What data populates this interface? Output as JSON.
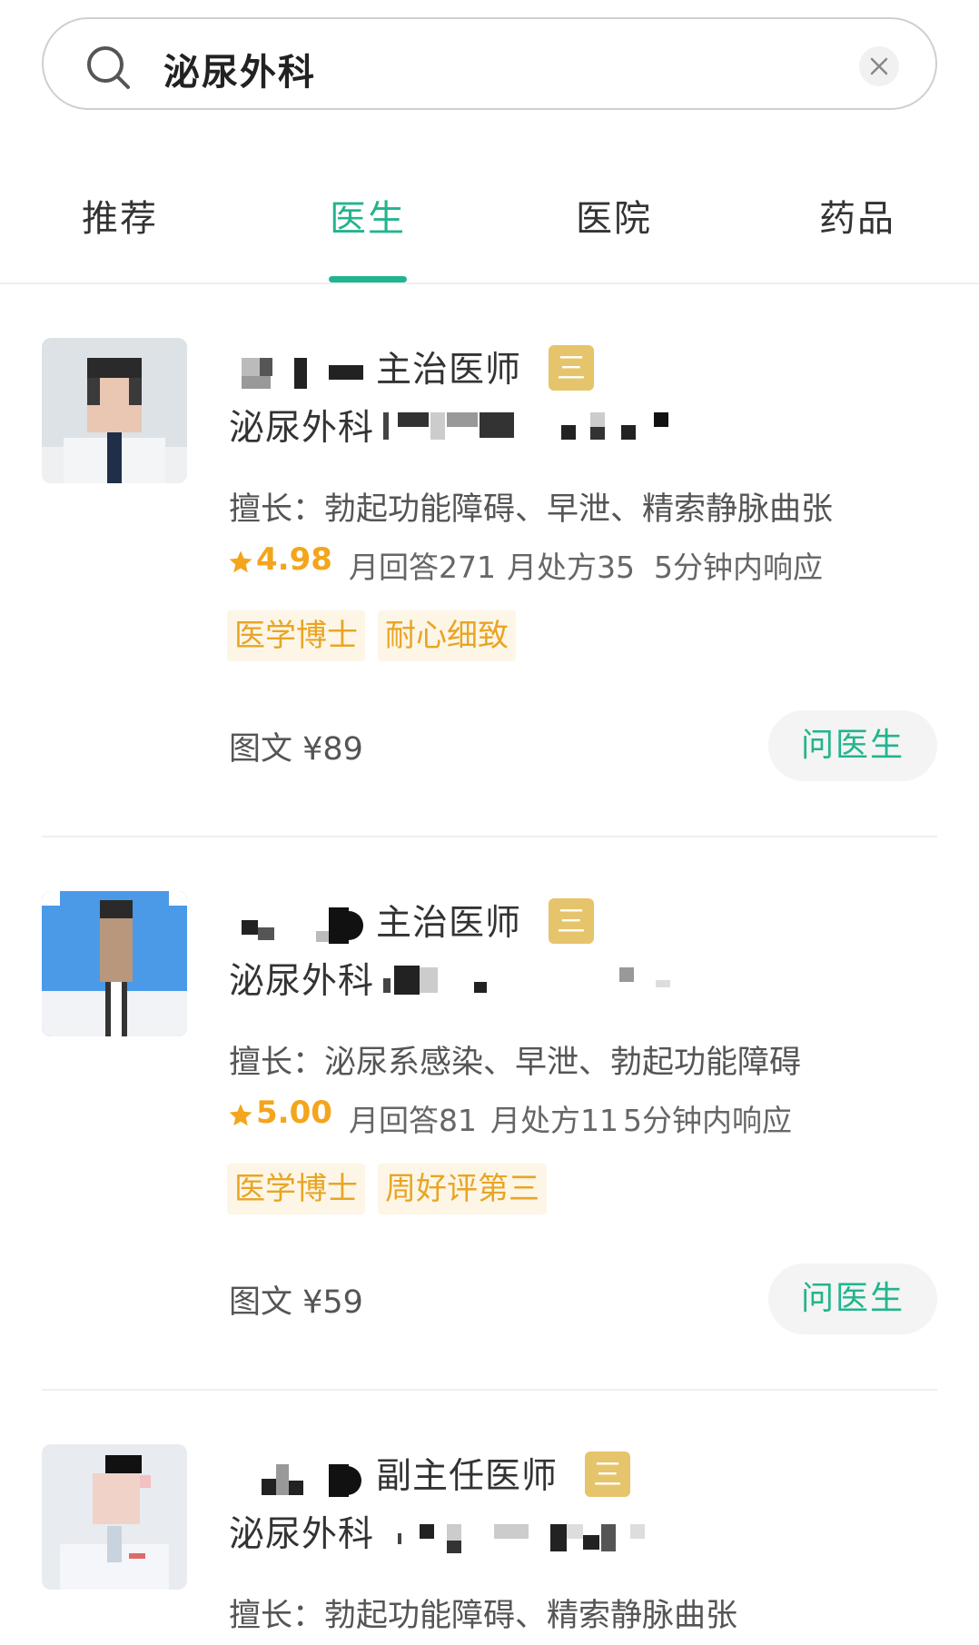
{
  "search": {
    "query": "泌尿外科",
    "icon": "search-icon",
    "clear_icon": "close-icon"
  },
  "tabs": [
    {
      "label": "推荐"
    },
    {
      "label": "医生",
      "active": true
    },
    {
      "label": "医院"
    },
    {
      "label": "药品"
    }
  ],
  "colors": {
    "accent": "#22b48e",
    "badge": "#e6c46b",
    "tag_text": "#e8a525",
    "rating": "#f3a51d"
  },
  "doctors": [
    {
      "title": "主治医师",
      "level_badge": "三甲",
      "department": "泌尿外科",
      "specialty": "擅长：勃起功能障碍、早泄、精索静脉曲张",
      "rating": "4.98",
      "monthly_answers": "月回答271",
      "monthly_prescriptions": "月处方35",
      "response": "5分钟内响应",
      "tags": [
        "医学博士",
        "耐心细致"
      ],
      "price": "图文 ¥89",
      "ask_label": "问医生"
    },
    {
      "title": "主治医师",
      "level_badge": "三甲",
      "department": "泌尿外科",
      "specialty": "擅长：泌尿系感染、早泄、勃起功能障碍",
      "rating": "5.00",
      "monthly_answers": "月回答81",
      "monthly_prescriptions": "月处方11",
      "response": "5分钟内响应",
      "tags": [
        "医学博士",
        "周好评第三"
      ],
      "price": "图文 ¥59",
      "ask_label": "问医生"
    },
    {
      "title": "副主任医师",
      "level_badge": "三甲",
      "department": "泌尿外科",
      "specialty": "擅长：勃起功能障碍、精索静脉曲张"
    }
  ]
}
